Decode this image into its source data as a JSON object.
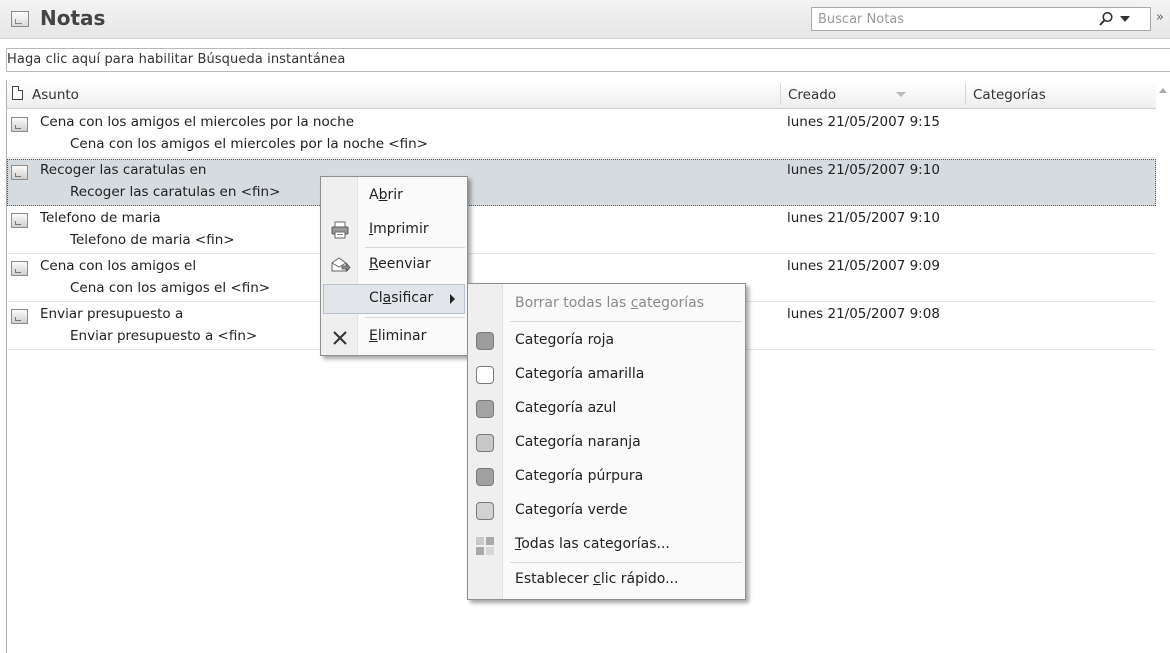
{
  "app": {
    "title": "Notas"
  },
  "search": {
    "placeholder": "Buscar Notas"
  },
  "instant_search": {
    "text": "Haga clic aquí para habilitar Búsqueda instantánea"
  },
  "columns": {
    "subject": "Asunto",
    "created": "Creado",
    "categories": "Categorías"
  },
  "notes": [
    {
      "subject": "Cena con los amigos el miercoles por la noche",
      "preview": "Cena con los amigos el miercoles por la noche <fin>",
      "created": "lunes 21/05/2007 9:15",
      "selected": false
    },
    {
      "subject": "Recoger las caratulas en",
      "preview": "Recoger las caratulas en <fin>",
      "created": "lunes 21/05/2007 9:10",
      "selected": true
    },
    {
      "subject": "Telefono de maria",
      "preview": "Telefono de maria <fin>",
      "created": "lunes 21/05/2007 9:10",
      "selected": false
    },
    {
      "subject": "Cena con los amigos el",
      "preview": "Cena con los amigos el <fin>",
      "created": "lunes 21/05/2007 9:09",
      "selected": false
    },
    {
      "subject": "Enviar presupuesto a",
      "preview": "Enviar presupuesto a <fin>",
      "created": "lunes 21/05/2007 9:08",
      "selected": false
    }
  ],
  "context_menu": {
    "open": {
      "pre": "A",
      "key": "b",
      "post": "rir"
    },
    "print": {
      "pre": "",
      "key": "I",
      "post": "mprimir"
    },
    "forward": {
      "pre": "",
      "key": "R",
      "post": "eenviar"
    },
    "categorize": {
      "pre": "Cl",
      "key": "a",
      "post": "sificar"
    },
    "delete": {
      "pre": "",
      "key": "E",
      "post": "liminar"
    }
  },
  "categories_menu": {
    "clear_all": {
      "pre": "Borrar todas las ",
      "key": "c",
      "post": "ategorías"
    },
    "items": [
      {
        "label": "Categoría roja",
        "color": "#9c9c9c"
      },
      {
        "label": "Categoría amarilla",
        "color": "#ffffff"
      },
      {
        "label": "Categoría azul",
        "color": "#a4a4a4"
      },
      {
        "label": "Categoría naranja",
        "color": "#c8c8c8"
      },
      {
        "label": "Categoría púrpura",
        "color": "#a0a0a0"
      },
      {
        "label": "Categoría verde",
        "color": "#d2d2d2"
      }
    ],
    "all_categories": {
      "pre": "",
      "key": "T",
      "post": "odas las categorías..."
    },
    "quick_click": {
      "pre": "Establecer ",
      "key": "c",
      "post": "lic rápido..."
    }
  }
}
